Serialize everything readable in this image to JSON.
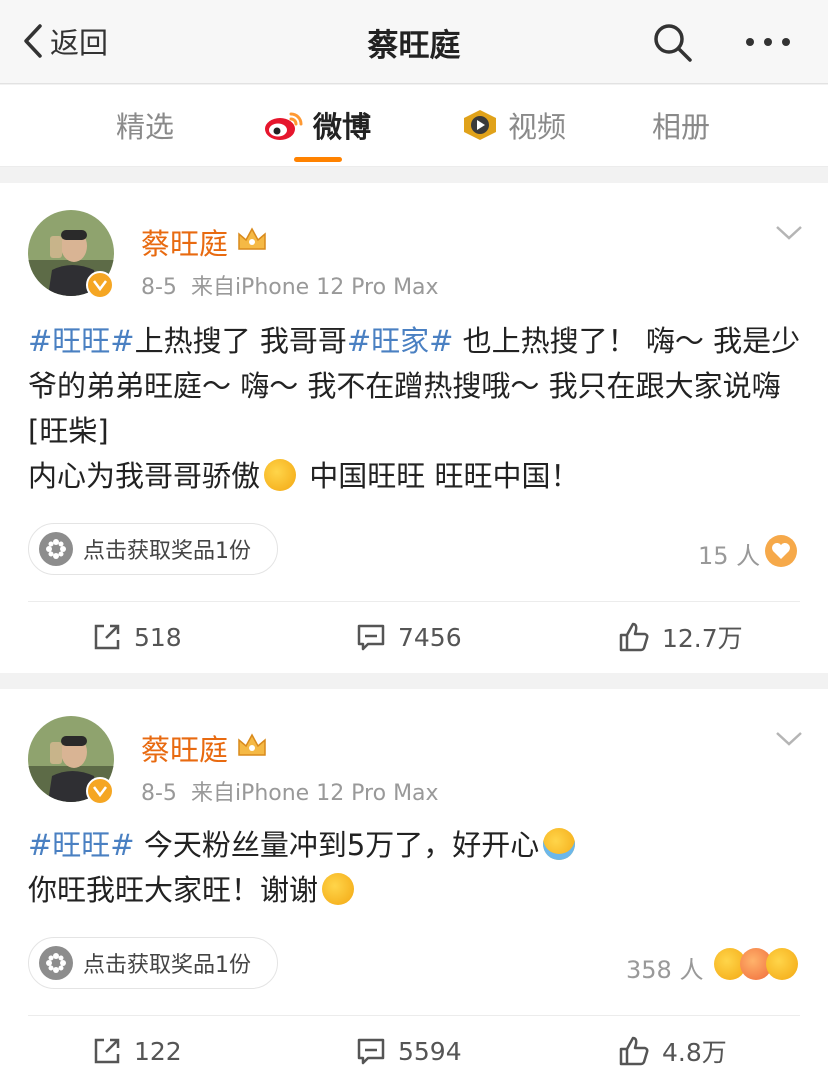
{
  "header": {
    "back_label": "返回",
    "title": "蔡旺庭"
  },
  "tabs": [
    {
      "label": "精选",
      "icon": "none",
      "active": false
    },
    {
      "label": "微博",
      "icon": "weibo-logo-icon",
      "active": true
    },
    {
      "label": "视频",
      "icon": "video-play-icon",
      "active": false
    },
    {
      "label": "相册",
      "icon": "none",
      "active": false
    }
  ],
  "colors": {
    "accent": "#ff8200",
    "username": "#e86a10",
    "hashtag": "#4a80c2"
  },
  "posts": [
    {
      "username": "蔡旺庭",
      "date": "8-5",
      "source": "来自iPhone 12 Pro Max",
      "tag1": "#旺旺#",
      "text1": "上热搜了 我哥哥",
      "tag2": "#旺家#",
      "text2": " 也上热搜了！ 嗨～ 我是少爷的弟弟旺庭～ 嗨～ 我不在蹭热搜哦～ 我只在跟大家说嗨[旺柴]",
      "line2": "内心为我哥哥骄傲",
      "line2_after": " 中国旺旺 旺旺中国！",
      "prize_label": "点击获取奖品1份",
      "people": "15 人",
      "reposts": "518",
      "comments": "7456",
      "likes": "12.7万"
    },
    {
      "username": "蔡旺庭",
      "date": "8-5",
      "source": "来自iPhone 12 Pro Max",
      "tag1": "#旺旺#",
      "text1": " 今天粉丝量冲到5万了，好开心",
      "line2": "你旺我旺大家旺！谢谢",
      "prize_label": "点击获取奖品1份",
      "people": "358 人",
      "reposts": "122",
      "comments": "5594",
      "likes": "4.8万"
    }
  ]
}
